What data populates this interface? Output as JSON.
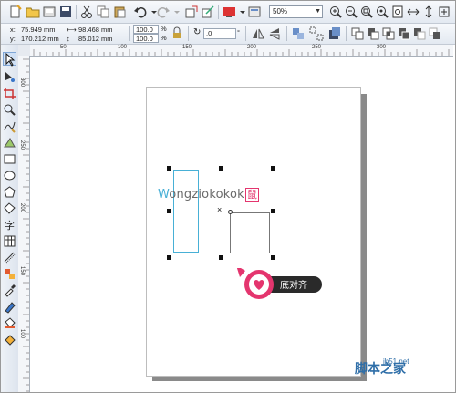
{
  "zoom": {
    "value": "50%"
  },
  "property_bar": {
    "x_label": "x:",
    "x_value": "75.949 mm",
    "y_label": "y:",
    "y_value": "170.212 mm",
    "w_value": "98.468 mm",
    "h_value": "85.012 mm",
    "scale_x": "100.0",
    "scale_y": "100.0",
    "percent_x": "%",
    "percent_y": "%",
    "rotation": ".0",
    "degree": "°"
  },
  "ruler": {
    "top_ticks": [
      "50",
      "100",
      "150",
      "200",
      "250",
      "300"
    ],
    "left_ticks": [
      "300",
      "250",
      "200",
      "150",
      "100"
    ]
  },
  "logo": {
    "first": "W",
    "rest": "ongziokokok",
    "badge": "鼠"
  },
  "callout": {
    "label": "底对齐"
  },
  "watermark": {
    "site": "jb51.net",
    "text": "脚本之家"
  },
  "colors": {
    "accent": "#e4356e",
    "logo_blue": "#48b0d6",
    "callout_bg": "#2a2a2a"
  }
}
